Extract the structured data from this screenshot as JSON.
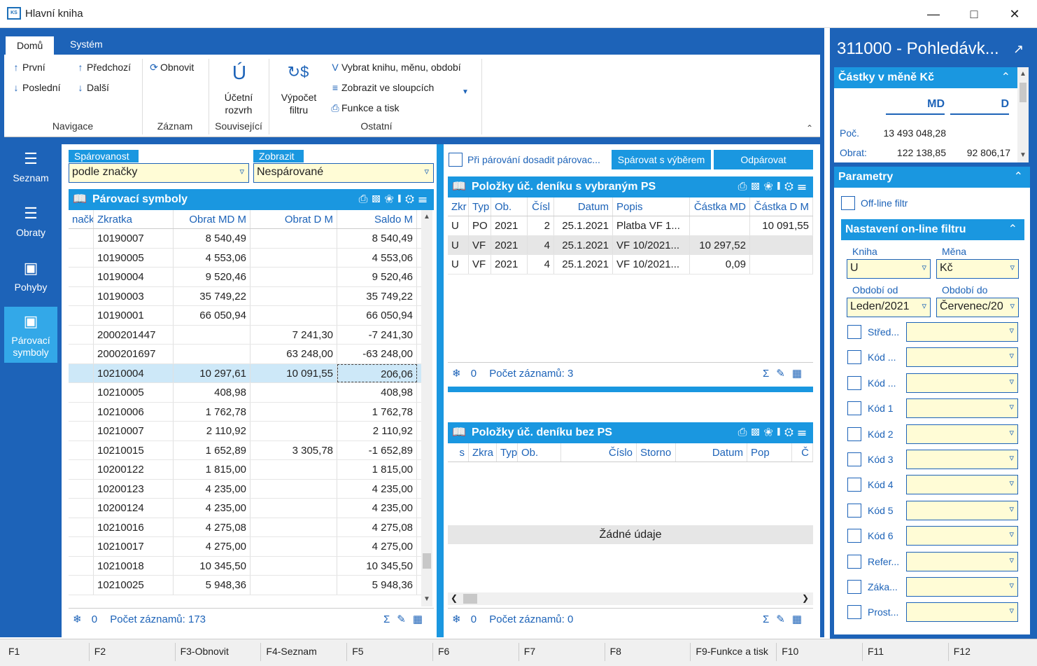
{
  "window": {
    "title": "Hlavní kniha",
    "icon_text": "KS"
  },
  "tabs": [
    {
      "label": "Domů"
    },
    {
      "label": "Systém"
    }
  ],
  "ribbon": {
    "nav": {
      "first": "První",
      "prev": "Předchozí",
      "last": "Poslední",
      "next": "Další",
      "group": "Navigace"
    },
    "record": {
      "refresh": "Obnovit",
      "group": "Záznam"
    },
    "related": {
      "entry_line1": "Účetní",
      "entry_line2": "rozvrh",
      "group": "Související"
    },
    "calc": {
      "line1": "Výpočet",
      "line2": "filtru"
    },
    "other": {
      "select": "Vybrat knihu, měnu, období",
      "columns": "Zobrazit ve sloupcích",
      "print": "Funkce a tisk",
      "group": "Ostatní"
    }
  },
  "leftnav": [
    {
      "label": "Seznam"
    },
    {
      "label": "Obraty"
    },
    {
      "label": "Pohyby"
    },
    {
      "label1": "Párovací",
      "label2": "symboly"
    }
  ],
  "pairing": {
    "label": "Spárovanost",
    "value": "podle značky"
  },
  "display": {
    "label": "Zobrazit",
    "value": "Nespárované"
  },
  "left_grid": {
    "title": "Párovací symboly",
    "columns": [
      "načk",
      "Zkratka",
      "Obrat MD M",
      "Obrat D M",
      "Saldo M"
    ],
    "rows": [
      [
        "10190007",
        "8 540,49",
        "",
        "8 540,49"
      ],
      [
        "10190005",
        "4 553,06",
        "",
        "4 553,06"
      ],
      [
        "10190004",
        "9 520,46",
        "",
        "9 520,46"
      ],
      [
        "10190003",
        "35 749,22",
        "",
        "35 749,22"
      ],
      [
        "10190001",
        "66 050,94",
        "",
        "66 050,94"
      ],
      [
        "2000201447",
        "",
        "7 241,30",
        "-7 241,30"
      ],
      [
        "2000201697",
        "",
        "63 248,00",
        "-63 248,00"
      ],
      [
        "10210004",
        "10 297,61",
        "10 091,55",
        "206,06"
      ],
      [
        "10210005",
        "408,98",
        "",
        "408,98"
      ],
      [
        "10210006",
        "1 762,78",
        "",
        "1 762,78"
      ],
      [
        "10210007",
        "2 110,92",
        "",
        "2 110,92"
      ],
      [
        "10210015",
        "1 652,89",
        "3 305,78",
        "-1 652,89"
      ],
      [
        "10200122",
        "1 815,00",
        "",
        "1 815,00"
      ],
      [
        "10200123",
        "4 235,00",
        "",
        "4 235,00"
      ],
      [
        "10200124",
        "4 235,00",
        "",
        "4 235,00"
      ],
      [
        "10210016",
        "4 275,08",
        "",
        "4 275,08"
      ],
      [
        "10210017",
        "4 275,00",
        "",
        "4 275,00"
      ],
      [
        "10210018",
        "10 345,50",
        "",
        "10 345,50"
      ],
      [
        "10210025",
        "5 948,36",
        "",
        "5 948,36"
      ]
    ],
    "status_count": "0",
    "status_text": "Počet záznamů: 173"
  },
  "pair_check": {
    "label": "Při párování dosadit párovac..."
  },
  "buttons": {
    "pair_selected": "Spárovat s výběrem",
    "unpair": "Odpárovat"
  },
  "top_grid": {
    "title": "Položky úč. deníku s vybraným PS",
    "columns": [
      "Zkr",
      "Typ",
      "Ob.",
      "Čísl",
      "Datum",
      "Popis",
      "Částka MD",
      "Částka D M"
    ],
    "rows": [
      [
        "U",
        "PO",
        "2021",
        "2",
        "25.1.2021",
        "Platba VF 1...",
        "",
        "10 091,55"
      ],
      [
        "U",
        "VF",
        "2021",
        "4",
        "25.1.2021",
        "VF 10/2021...",
        "10 297,52",
        ""
      ],
      [
        "U",
        "VF",
        "2021",
        "4",
        "25.1.2021",
        "VF 10/2021...",
        "0,09",
        ""
      ]
    ],
    "status_count": "0",
    "status_text": "Počet záznamů: 3"
  },
  "bottom_grid": {
    "title": "Položky úč. deníku bez PS",
    "columns": [
      "s",
      "Zkra",
      "Typ",
      "Ob.",
      "Číslo",
      "Storno",
      "Datum",
      "Pop",
      "Č"
    ],
    "empty": "Žádné údaje",
    "status_count": "0",
    "status_text": "Počet záznamů: 0"
  },
  "right": {
    "title": "311000 - Pohledávk...",
    "amounts": {
      "title": "Částky v měně Kč",
      "md": "MD",
      "d": "D",
      "poc_label": "Poč.",
      "poc_md": "13 493 048,28",
      "obrat_label": "Obrat:",
      "obrat_md": "122 138,85",
      "obrat_d": "92 806,17"
    },
    "params": {
      "title": "Parametry",
      "offline": "Off-line filtr"
    },
    "online": {
      "title": "Nastavení on-line filtru",
      "kniha_label": "Kniha",
      "kniha": "U",
      "mena_label": "Měna",
      "mena": "Kč",
      "od_label": "Období od",
      "od": "Leden/2021",
      "do_label": "Období do",
      "do": "Červenec/20"
    },
    "filters": [
      "Střed...",
      "Kód ...",
      "Kód ...",
      "Kód 1",
      "Kód 2",
      "Kód 3",
      "Kód 4",
      "Kód 5",
      "Kód 6",
      "Refer...",
      "Záka...",
      "Prost..."
    ]
  },
  "fkeys": [
    "F1",
    "F2",
    "F3-Obnovit",
    "F4-Seznam",
    "F5",
    "F6",
    "F7",
    "F8",
    "F9-Funkce a tisk",
    "F10",
    "F11",
    "F12"
  ]
}
